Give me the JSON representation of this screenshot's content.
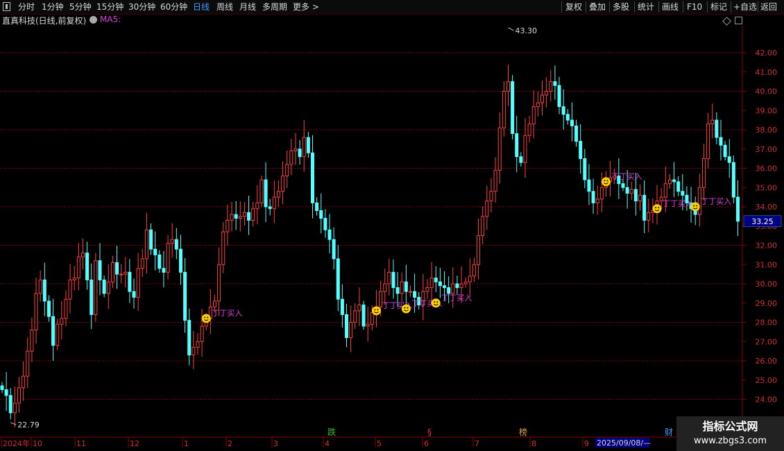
{
  "toolbar": {
    "left_items": [
      "分时",
      "1分钟",
      "5分钟",
      "15分钟",
      "30分钟",
      "60分钟",
      "日线",
      "周线",
      "月线",
      "多周期",
      "更多 >"
    ],
    "active_item": "日线",
    "right_items": [
      "复权",
      "叠加",
      "多股",
      "统计",
      "画线",
      "F10",
      "标记",
      "+自选",
      "返回"
    ]
  },
  "header": {
    "stock_title": "直真科技(日线,前复权)",
    "indicator_label": "MA5:"
  },
  "chart_data": {
    "type": "candlestick",
    "ylim": [
      23.0,
      43.8
    ],
    "y_ticks": [
      24.0,
      25.0,
      26.0,
      27.0,
      28.0,
      29.0,
      30.0,
      31.0,
      32.0,
      33.0,
      34.0,
      35.0,
      36.0,
      37.0,
      38.0,
      39.0,
      40.0,
      41.0,
      42.0
    ],
    "y_tick_labels": [
      "24.00",
      "25.00",
      "26.00",
      "27.00",
      "28.00",
      "29.00",
      "30.00",
      "31.00",
      "32.00",
      "33.00",
      "34.00",
      "35.00",
      "36.00",
      "37.00",
      "38.00",
      "39.00",
      "40.00",
      "41.00",
      "42.00"
    ],
    "grid_dashed_levels": [
      24.0,
      26.0,
      28.0,
      30.0,
      32.0,
      34.0,
      36.0,
      38.0,
      40.0,
      42.0
    ],
    "current_price": "33.25",
    "high_marker": {
      "label": "43.30",
      "value": 43.3
    },
    "low_marker": {
      "label": "22.79",
      "value": 22.79
    },
    "x_labels": [
      "2024年",
      "10",
      "11",
      "12",
      "1",
      "2",
      "3",
      "4",
      "5",
      "6",
      "7",
      "8",
      "9"
    ],
    "date_box": "2025/09/08/—",
    "events": [
      {
        "label": "跌",
        "color": "#30c030"
      },
      {
        "label": "§",
        "color": "#e03030"
      },
      {
        "label": "榜",
        "color": "#e0a040"
      },
      {
        "label": "财",
        "color": "#3aa0ff"
      }
    ],
    "buy_signal_label": "丁丁买入",
    "buy_signals": [
      {
        "index": 48,
        "price": 28.2
      },
      {
        "index": 88,
        "price": 28.6
      },
      {
        "index": 95,
        "price": 28.7
      },
      {
        "index": 102,
        "price": 29.0
      },
      {
        "index": 142,
        "price": 35.3
      },
      {
        "index": 154,
        "price": 33.9
      },
      {
        "index": 163,
        "price": 34.0
      }
    ],
    "closes": [
      24.5,
      24.2,
      23.3,
      23.8,
      24.6,
      25.2,
      26.5,
      27.6,
      29.5,
      30.2,
      29.1,
      28.3,
      26.8,
      27.9,
      28.2,
      29.2,
      30.2,
      30.3,
      31.4,
      31.6,
      30.2,
      28.4,
      31.2,
      30.2,
      29.5,
      30.1,
      31.1,
      30.5,
      30.5,
      30.6,
      29.6,
      29.3,
      30.8,
      31.3,
      32.8,
      31.8,
      31.5,
      30.8,
      30.6,
      32.1,
      32.3,
      31.8,
      30.6,
      28.1,
      26.3,
      26.7,
      27.0,
      27.8,
      28.2,
      28.8,
      29.1,
      31.0,
      32.7,
      33.3,
      33.6,
      33.4,
      33.5,
      33.7,
      33.3,
      33.9,
      34.2,
      35.4,
      34.0,
      33.9,
      34.5,
      34.8,
      35.6,
      36.2,
      36.9,
      37.0,
      36.6,
      37.6,
      36.8,
      34.2,
      33.8,
      33.4,
      32.8,
      32.3,
      31.3,
      29.2,
      28.4,
      27.2,
      28.0,
      28.6,
      28.9,
      27.8,
      27.9,
      28.5,
      28.8,
      29.6,
      30.0,
      30.6,
      29.8,
      29.5,
      30.1,
      29.6,
      29.6,
      29.3,
      28.9,
      29.6,
      29.8,
      30.3,
      30.1,
      29.9,
      29.8,
      29.5,
      30.0,
      29.8,
      30.0,
      30.1,
      30.4,
      31.0,
      32.5,
      33.5,
      34.3,
      34.8,
      35.9,
      38.1,
      40.0,
      40.5,
      37.8,
      36.6,
      36.3,
      37.7,
      38.3,
      39.2,
      39.4,
      39.8,
      40.0,
      40.5,
      40.3,
      39.2,
      38.8,
      38.5,
      38.2,
      37.4,
      36.5,
      35.4,
      34.8,
      34.2,
      34.4,
      35.0,
      35.3,
      35.5,
      35.6,
      35.2,
      35.0,
      34.7,
      34.9,
      34.3,
      34.6,
      33.3,
      33.7,
      33.8,
      34.3,
      34.5,
      35.2,
      35.4,
      35.3,
      34.8,
      34.6,
      34.2,
      33.9,
      33.6,
      35.0,
      36.5,
      38.3,
      38.5,
      37.6,
      37.2,
      36.6,
      36.3,
      34.5,
      33.25
    ]
  },
  "watermark": {
    "line1": "指标公式网",
    "line2": "www.zbgs3.com"
  },
  "colors": {
    "up": "#ff4040",
    "down": "#54ffff",
    "grid": "#8a0000",
    "axis_text": "#d03030",
    "signal_text": "#e040e0",
    "smiley": "#ffd000",
    "price_box": "#000080"
  }
}
